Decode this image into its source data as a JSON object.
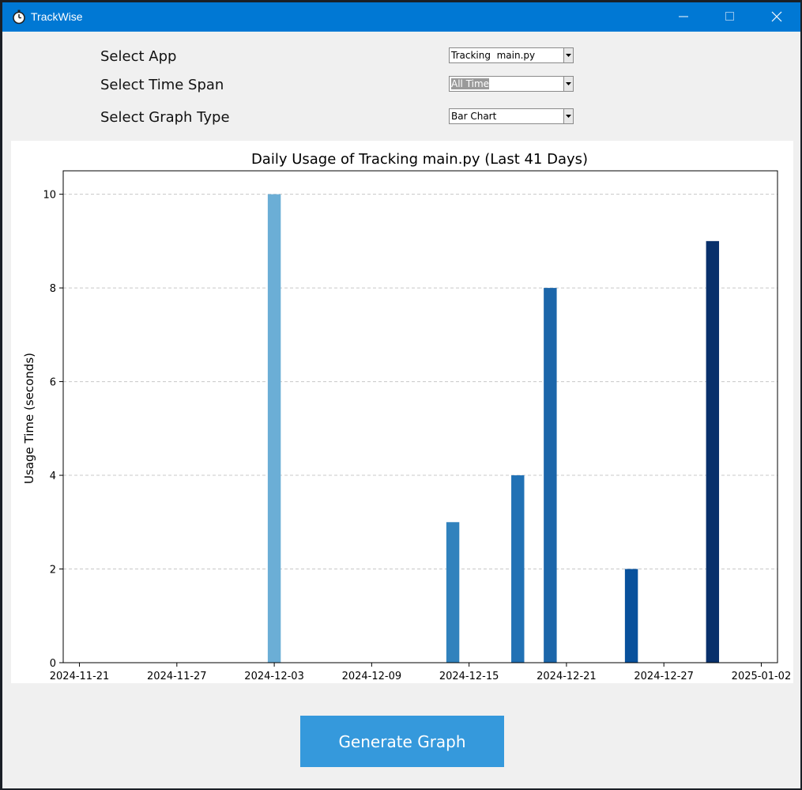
{
  "window": {
    "title": "TrackWise",
    "icon": "stopwatch-icon",
    "controls": [
      "minimize-icon",
      "maximize-icon",
      "close-icon"
    ]
  },
  "form": {
    "app_label": "Select App",
    "app_value": "Tracking  main.py",
    "timespan_label": "Select Time Span",
    "timespan_value": "All Time",
    "graphtype_label": "Select Graph Type",
    "graphtype_value": "Bar Chart"
  },
  "generate_button": "Generate Graph",
  "colors": {
    "titlebar": "#0078d4",
    "button": "#3599dc"
  },
  "chart_data": {
    "type": "bar",
    "title": "Daily Usage of Tracking  main.py (Last 41 Days)",
    "xlabel": "",
    "ylabel": "Usage Time (seconds)",
    "ylim": [
      0,
      10.5
    ],
    "yticks": [
      0,
      2,
      4,
      6,
      8,
      10
    ],
    "xlim": [
      "2024-11-20",
      "2025-01-03"
    ],
    "xticks": [
      "2024-11-21",
      "2024-11-27",
      "2024-12-03",
      "2024-12-09",
      "2024-12-15",
      "2024-12-21",
      "2024-12-27",
      "2025-01-02"
    ],
    "grid": "y-dashed",
    "bars": [
      {
        "date": "2024-12-03",
        "value": 10,
        "color": "#6baed6"
      },
      {
        "date": "2024-12-14",
        "value": 3,
        "color": "#3182bd"
      },
      {
        "date": "2024-12-18",
        "value": 4,
        "color": "#2171b5"
      },
      {
        "date": "2024-12-20",
        "value": 8,
        "color": "#1c66aa"
      },
      {
        "date": "2024-12-25",
        "value": 2,
        "color": "#08519c"
      },
      {
        "date": "2024-12-30",
        "value": 9,
        "color": "#08306b"
      }
    ]
  }
}
